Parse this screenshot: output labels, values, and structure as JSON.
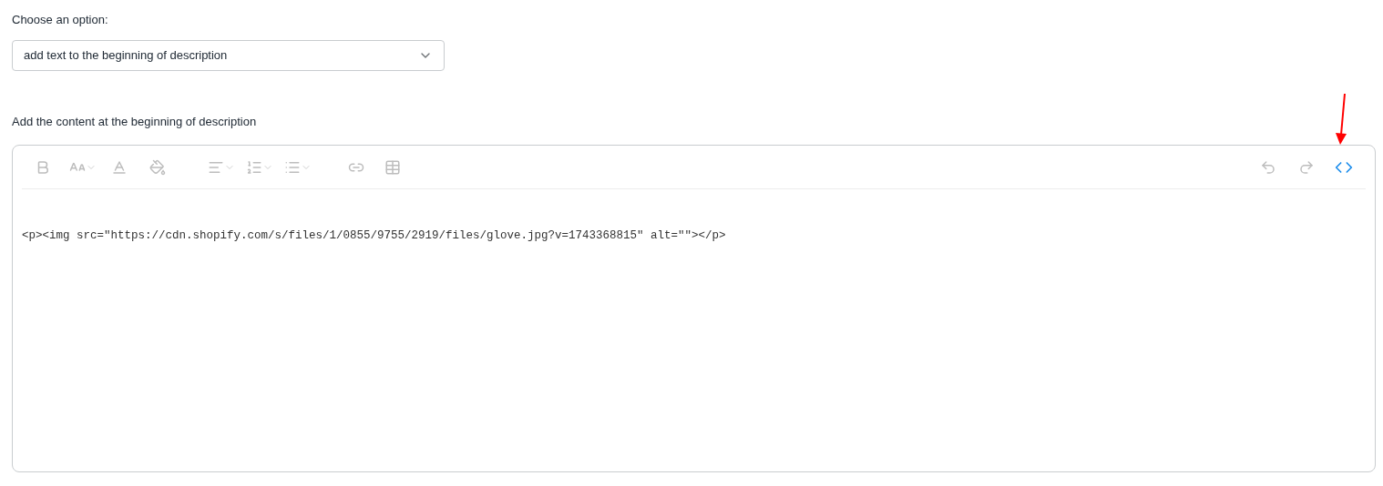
{
  "option_label": "Choose an option:",
  "select": {
    "value": "add text to the beginning of description"
  },
  "content_label": "Add the content at the beginning of description",
  "editor": {
    "code_view": {
      "on": true
    },
    "code": "<p><img src=\"https://cdn.shopify.com/s/files/1/0855/9755/2919/files/glove.jpg?v=1743368815\" alt=\"\"></p>"
  }
}
